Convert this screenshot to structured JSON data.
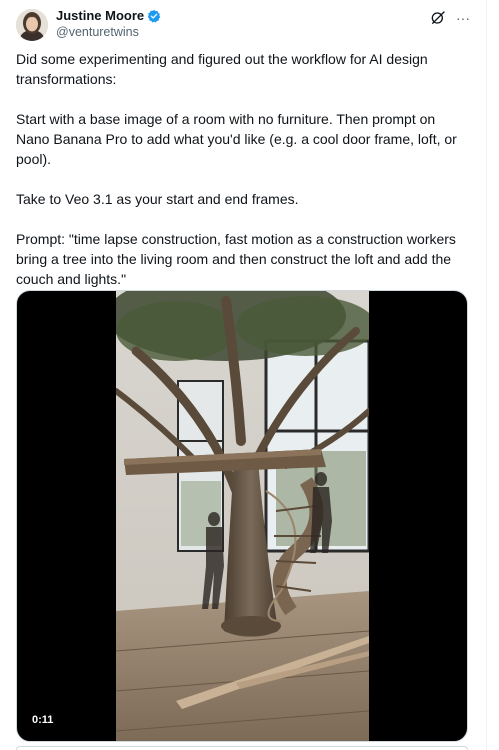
{
  "author": {
    "display_name": "Justine Moore",
    "handle": "@venturetwins",
    "verified_icon": "verified-badge-icon",
    "verified_color": "#1d9bf0"
  },
  "header_actions": {
    "grok_icon": "grok-icon",
    "more_label": "···"
  },
  "tweet": {
    "paragraphs": [
      "Did some experimenting and figured out the workflow for AI design transformations:",
      "Start with a base image of a room with no furniture. Then prompt on Nano Banana Pro to add what you'd like (e.g. a cool door frame, loft, or pool).",
      "Take to Veo 3.1 as your start and end frames.",
      "Prompt: \"time lapse construction, fast motion as a construction workers bring a tree into the living room and then construct the loft and add the couch and lights.\""
    ]
  },
  "media": {
    "type": "video",
    "timestamp": "0:11"
  },
  "colors": {
    "text": "#0f1419",
    "secondary": "#536471",
    "border": "#cfd9de"
  }
}
